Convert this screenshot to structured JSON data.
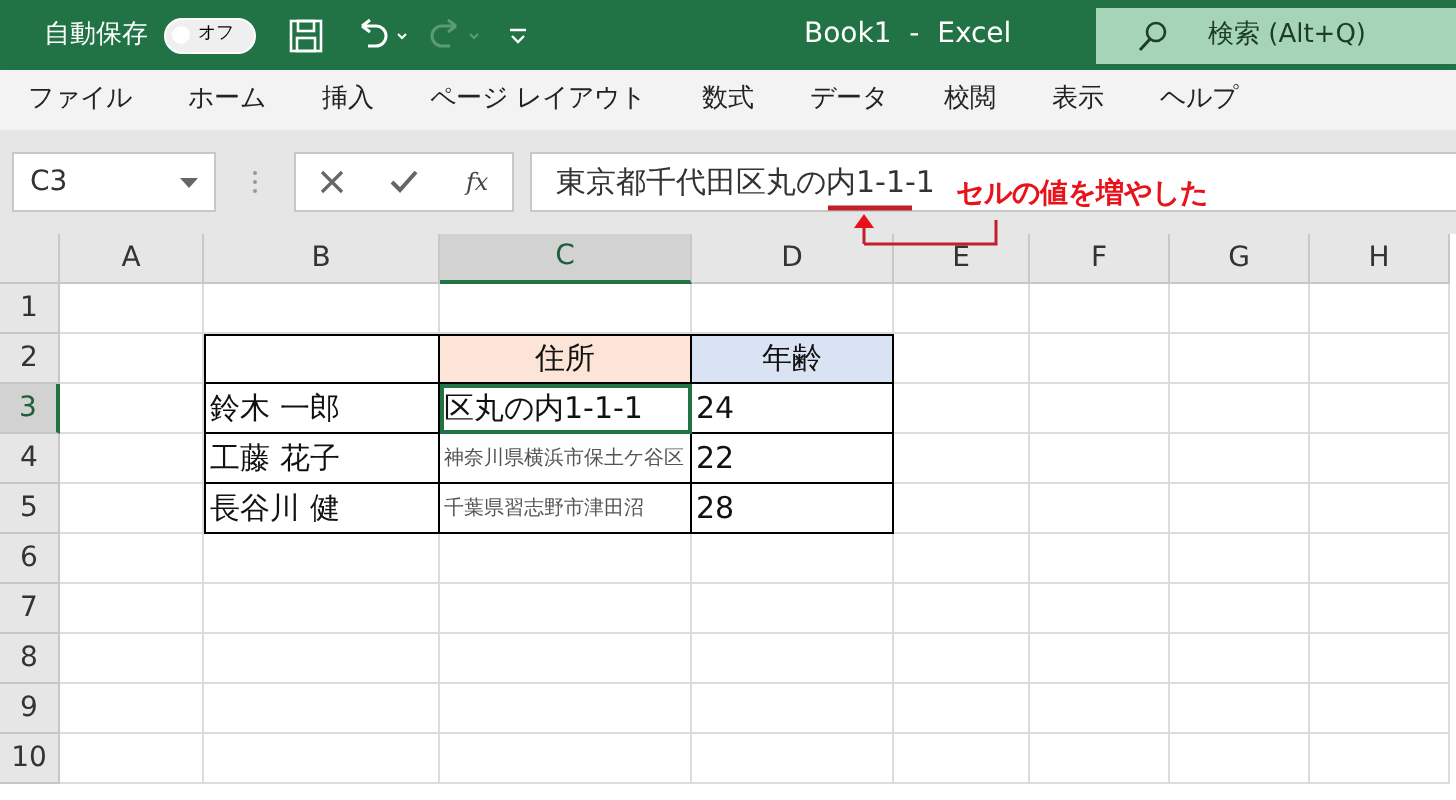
{
  "title_bar": {
    "autosave_label": "自動保存",
    "autosave_on": false,
    "autosave_state_text": "オフ",
    "undo_enabled": true,
    "redo_enabled": false,
    "title": "Book1  -  Excel",
    "search_placeholder": "検索 (Alt+Q)"
  },
  "ribbon_tabs": [
    {
      "label": "ファイル",
      "selected": false
    },
    {
      "label": "ホーム",
      "selected": false
    },
    {
      "label": "挿入",
      "selected": false
    },
    {
      "label": "ページ レイアウト",
      "selected": false
    },
    {
      "label": "数式",
      "selected": false
    },
    {
      "label": "データ",
      "selected": false
    },
    {
      "label": "校閲",
      "selected": false
    },
    {
      "label": "表示",
      "selected": false
    },
    {
      "label": "ヘルプ",
      "selected": false
    }
  ],
  "formula_bar": {
    "name_box": "C3",
    "function_label": "fx",
    "value": "東京都千代田区丸の内1-1-1"
  },
  "annotation": {
    "text": "セルの値を増やした"
  },
  "columns": [
    {
      "label": "A",
      "selected": false
    },
    {
      "label": "B",
      "selected": false
    },
    {
      "label": "C",
      "selected": true
    },
    {
      "label": "D",
      "selected": false
    },
    {
      "label": "E",
      "selected": false
    },
    {
      "label": "F",
      "selected": false
    },
    {
      "label": "G",
      "selected": false
    },
    {
      "label": "H",
      "selected": false
    }
  ],
  "row_headers": [
    {
      "label": "1",
      "selected": false
    },
    {
      "label": "2",
      "selected": false
    },
    {
      "label": "3",
      "selected": true
    },
    {
      "label": "4",
      "selected": false
    },
    {
      "label": "5",
      "selected": false
    },
    {
      "label": "6",
      "selected": false
    },
    {
      "label": "7",
      "selected": false
    },
    {
      "label": "8",
      "selected": false
    },
    {
      "label": "9",
      "selected": false
    },
    {
      "label": "10",
      "selected": false
    }
  ],
  "table": {
    "header": {
      "address": "住所",
      "age": "年齢"
    },
    "rows": [
      {
        "name": "鈴木 一郎",
        "address": "区丸の内1-1-1",
        "shrink_to_fit": false,
        "active": true,
        "age": "24"
      },
      {
        "name": "工藤 花子",
        "address": "神奈川県横浜市保土ケ谷区",
        "shrink_to_fit": true,
        "active": false,
        "age": "22"
      },
      {
        "name": "長谷川 健",
        "address": "千葉県習志野市津田沼",
        "shrink_to_fit": true,
        "active": false,
        "age": "28"
      }
    ]
  }
}
